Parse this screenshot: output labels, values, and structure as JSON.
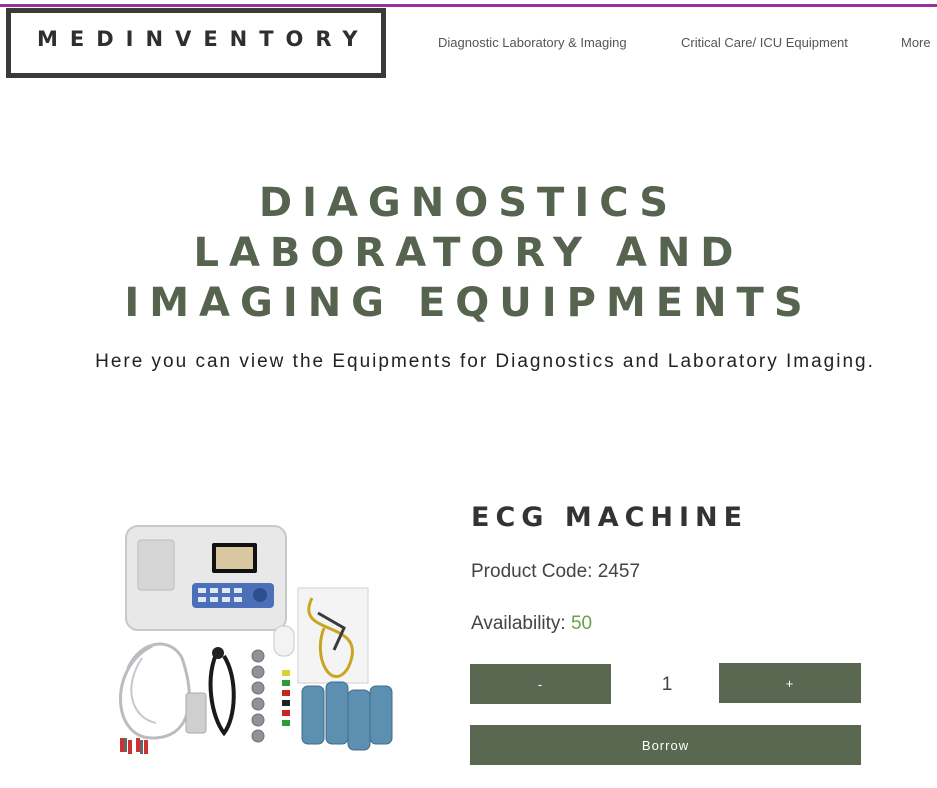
{
  "header": {
    "logo": "MEDINVENTORY",
    "nav": [
      "Diagnostic Laboratory & Imaging",
      "Critical Care/ ICU Equipment",
      "More"
    ]
  },
  "hero": {
    "title_lines": [
      "DIAGNOSTICS",
      "LABORATORY AND",
      "IMAGING EQUIPMENTS"
    ],
    "subtitle": "Here you can view the Equipments for Diagnostics and Laboratory Imaging."
  },
  "product": {
    "name": "ECG MACHINE",
    "code_label": "Product Code: 2457",
    "availability_label": "Availability:",
    "availability_value": "50",
    "quantity": "1",
    "minus_label": "-",
    "plus_label": "+",
    "borrow_label": "Borrow",
    "image_icon": "ecg-machine-photo"
  },
  "colors": {
    "accent": "#5a6751",
    "title": "#56634f",
    "top_line": "#9b2f9b",
    "availability": "#6aa14a"
  }
}
